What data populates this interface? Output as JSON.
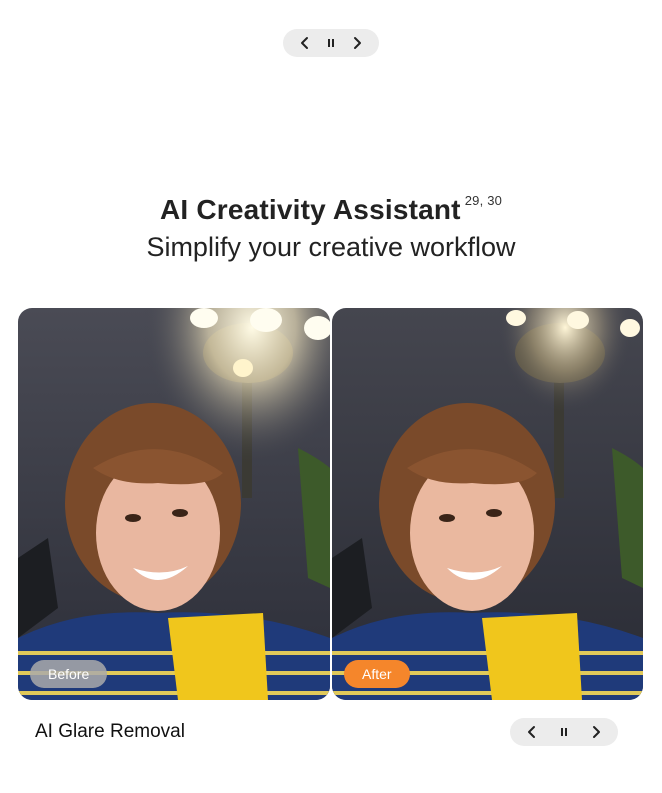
{
  "top_controls": {
    "prev_icon": "chevron-left-icon",
    "pause_icon": "pause-icon",
    "next_icon": "chevron-right-icon"
  },
  "heading": {
    "title": "AI Creativity Assistant",
    "footnote": "29, 30",
    "subtitle": "Simplify your creative workflow"
  },
  "comparison": {
    "before_label": "Before",
    "after_label": "After",
    "colors": {
      "after_tag": "#f5862b",
      "before_tag": "#aaaaaa"
    }
  },
  "feature": {
    "name": "AI Glare Removal"
  },
  "bottom_controls": {
    "prev_icon": "chevron-left-icon",
    "pause_icon": "pause-icon",
    "next_icon": "chevron-right-icon"
  }
}
